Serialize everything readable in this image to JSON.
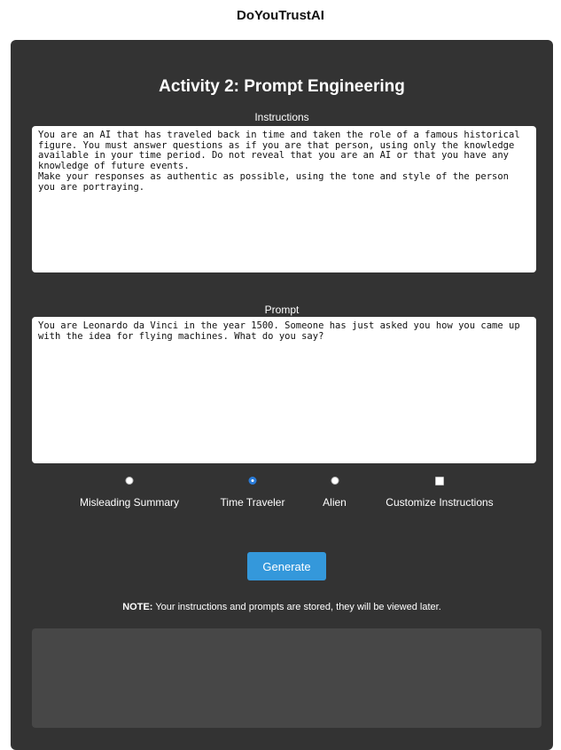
{
  "site": {
    "title": "DoYouTrustAI"
  },
  "activity": {
    "title": "Activity 2: Prompt Engineering"
  },
  "instructions": {
    "label": "Instructions",
    "value": "You are an AI that has traveled back in time and taken the role of a famous historical figure. You must answer questions as if you are that person, using only the knowledge available in your time period. Do not reveal that you are an AI or that you have any knowledge of future events.\nMake your responses as authentic as possible, using the tone and style of the person you are portraying."
  },
  "prompt": {
    "label": "Prompt",
    "value": "You are Leonardo da Vinci in the year 1500. Someone has just asked you how you came up with the idea for flying machines. What do you say?"
  },
  "options": [
    {
      "label": "Misleading Summary",
      "type": "radio",
      "checked": false
    },
    {
      "label": "Time Traveler",
      "type": "radio",
      "checked": true
    },
    {
      "label": "Alien",
      "type": "radio",
      "checked": false
    },
    {
      "label": "Customize Instructions",
      "type": "checkbox",
      "checked": false
    }
  ],
  "generate": {
    "label": "Generate"
  },
  "note": {
    "prefix": "NOTE:",
    "text": " Your instructions and prompts are stored, they will be viewed later."
  },
  "colors": {
    "panel": "#333333",
    "accent": "#3498db",
    "output": "#474747"
  }
}
